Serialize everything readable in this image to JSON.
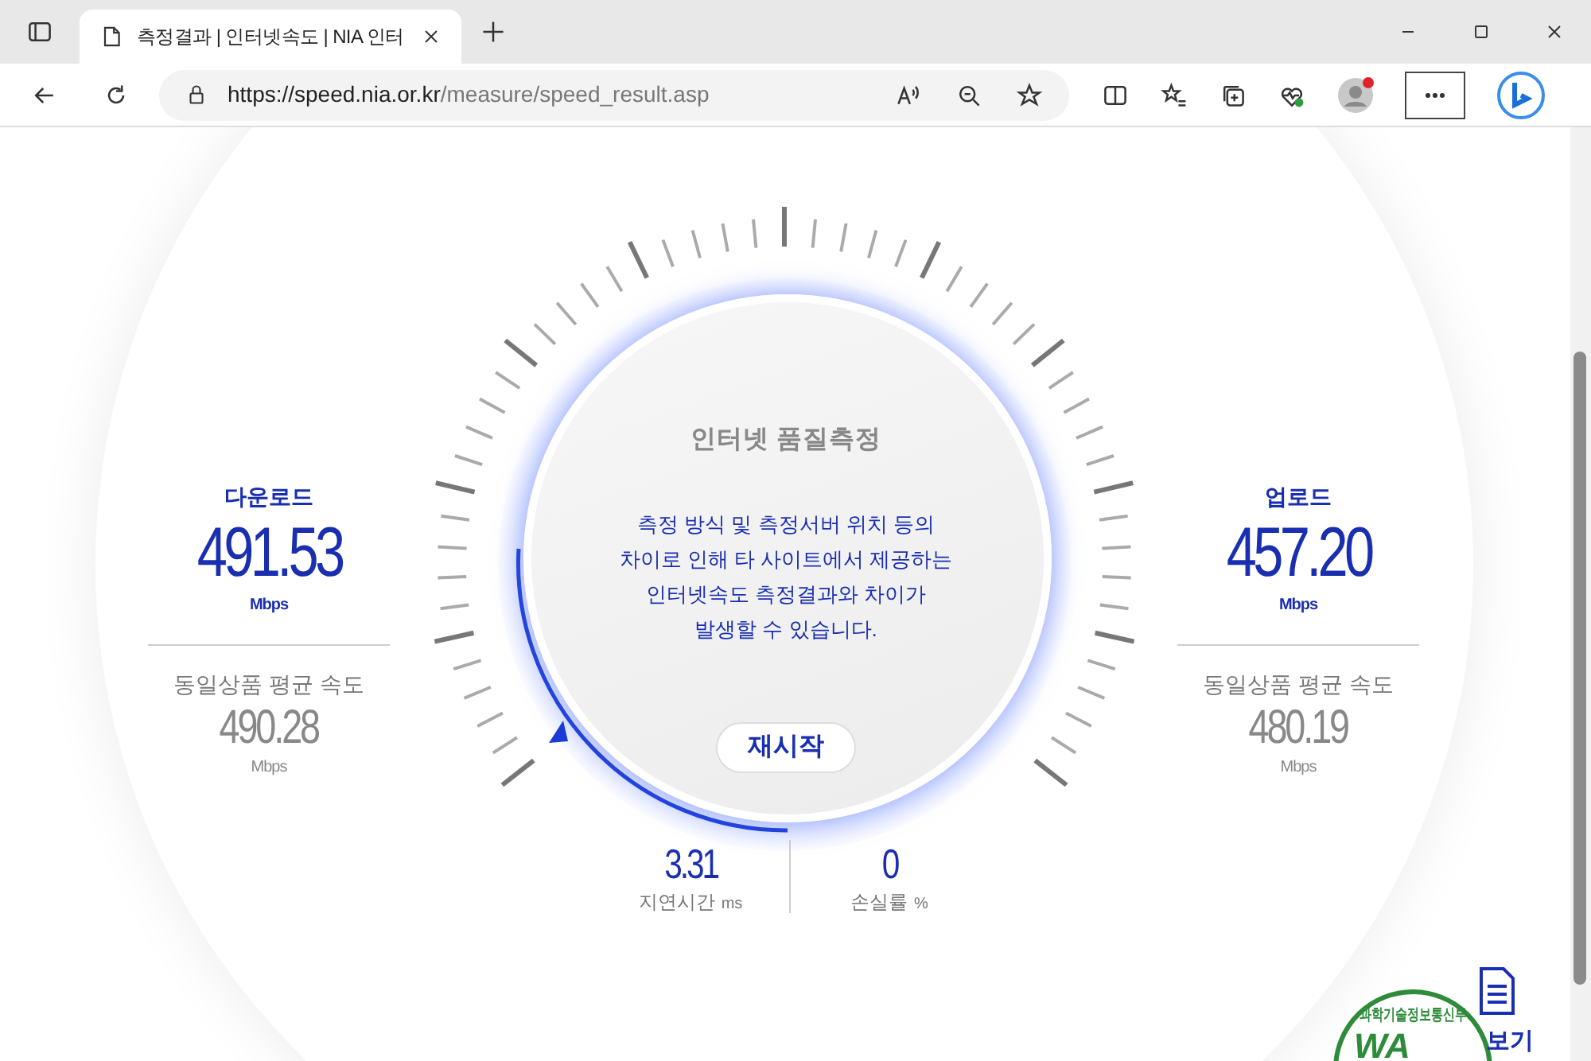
{
  "browser": {
    "tab_title": "측정결과 | 인터넷속도 | NIA 인터",
    "url_host": "https://speed.nia.or.kr",
    "url_path": "/measure/speed_result.asp"
  },
  "gauge": {
    "title": "인터넷 품질측정",
    "notice": "측정 방식 및 측정서버 위치 등의 차이로 인해 타 사이트에서 제공하는 인터넷속도 측정결과와 차이가 발생할 수 있습니다.",
    "restart_button": "재시작"
  },
  "results": [
    {
      "label": "다운로드",
      "value": "491.53",
      "unit": "Mbps",
      "avg_label": "동일상품 평균 속도",
      "avg_value": "490.28",
      "avg_unit": "Mbps"
    },
    {
      "label": "업로드",
      "value": "457.20",
      "unit": "Mbps",
      "avg_label": "동일상품 평균 속도",
      "avg_value": "480.19",
      "avg_unit": "Mbps"
    }
  ],
  "stats": [
    {
      "value": "3.31",
      "label": "지연시간",
      "unit": "ms"
    },
    {
      "value": "0",
      "label": "손실률",
      "unit": "%"
    }
  ],
  "footer": {
    "badge_top": "과학기술정보통신부",
    "badge_mark": "WA",
    "view_link": "보기"
  }
}
